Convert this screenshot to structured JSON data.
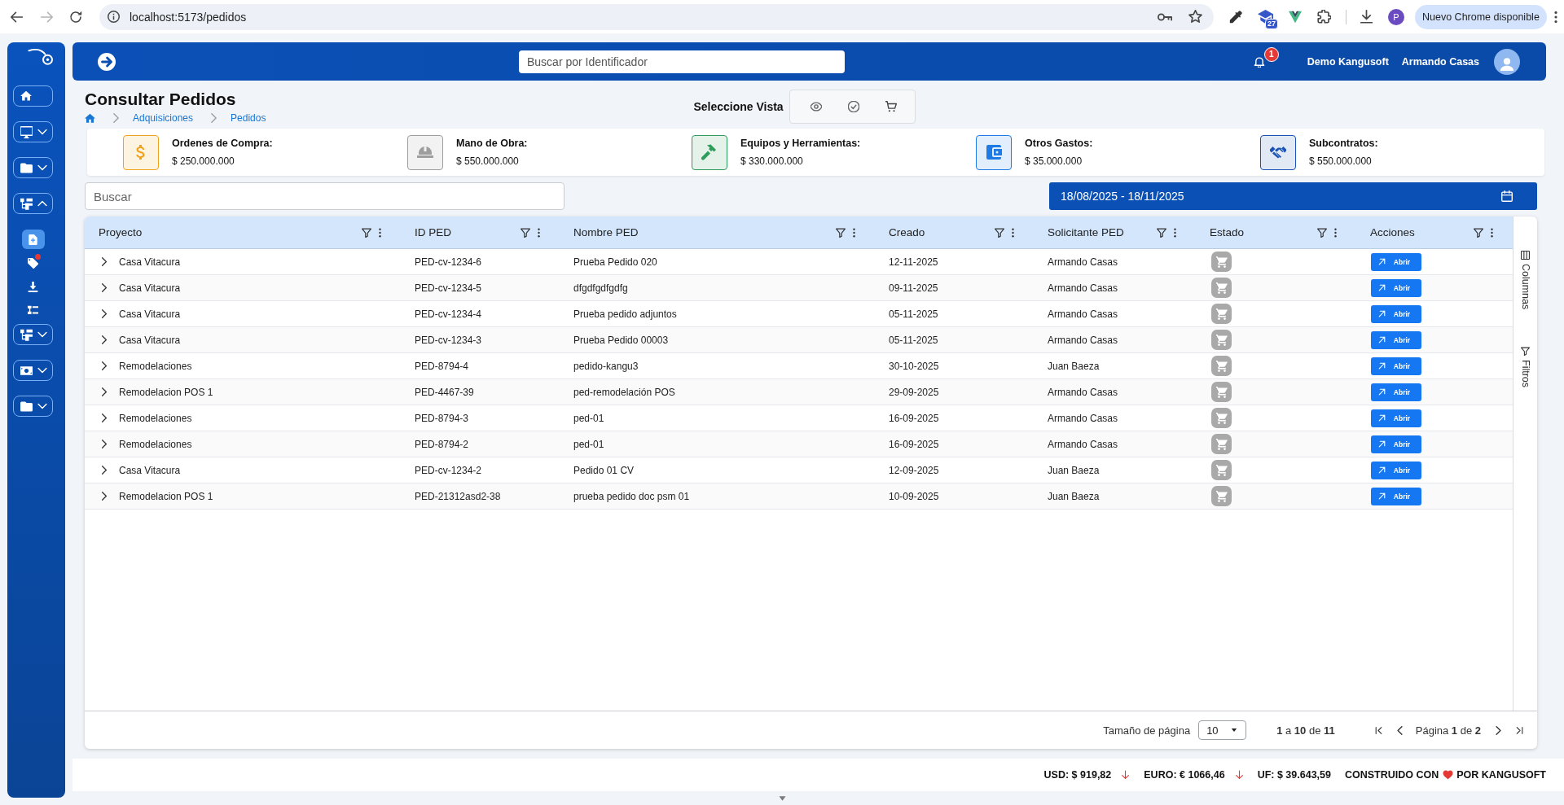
{
  "browser": {
    "url": "localhost:5173/pedidos",
    "extension_badge": "27",
    "profile_initial": "P",
    "update_button": "Nuevo Chrome disponible"
  },
  "sidebar": {
    "items": [
      {
        "kind": "link"
      },
      {
        "kind": "group",
        "expanded": false
      },
      {
        "kind": "group",
        "expanded": false
      },
      {
        "kind": "group",
        "expanded": true,
        "children": [
          {
            "selected": true,
            "notification": false
          },
          {
            "selected": false,
            "notification": true
          },
          {
            "selected": false,
            "notification": false
          },
          {
            "selected": false,
            "notification": false
          }
        ]
      },
      {
        "kind": "group",
        "expanded": false
      },
      {
        "kind": "group",
        "expanded": false
      },
      {
        "kind": "group",
        "expanded": false
      }
    ]
  },
  "header": {
    "search": {
      "placeholder": "Buscar por Identificador"
    },
    "notifications": "1",
    "company": "Demo Kangusoft",
    "user": "Armando Casas"
  },
  "page": {
    "title": "Consultar Pedidos",
    "breadcrumb": [
      "Adquisiciones",
      "Pedidos"
    ],
    "view_selector": {
      "label": "Seleccione Vista"
    }
  },
  "summary": [
    {
      "label": "Ordenes de Compra:",
      "value": "$ 250.000.000",
      "color": "#f0a31a"
    },
    {
      "label": "Mano de Obra:",
      "value": "$ 550.000.000",
      "color": "#9e9e9e"
    },
    {
      "label": "Equipos y Herramientas:",
      "value": "$ 330.000.000",
      "color": "#2e9d5c"
    },
    {
      "label": "Otros Gastos:",
      "value": "$ 35.000.000",
      "color": "#1e7be6"
    },
    {
      "label": "Subcontratos:",
      "value": "$ 550.000.000",
      "color": "#1a52b5"
    }
  ],
  "filters": {
    "search": {
      "placeholder": "Buscar"
    },
    "date_range": "18/08/2025 - 18/11/2025"
  },
  "table": {
    "columns": [
      "Proyecto",
      "ID PED",
      "Nombre PED",
      "Creado",
      "Solicitante PED",
      "Estado",
      "Acciones"
    ],
    "rows": [
      {
        "expanded": false,
        "cells": [
          "Casa Vitacura",
          "PED-cv-1234-6",
          "Prueba Pedido 020",
          "12-11-2025",
          "Armando Casas"
        ],
        "action": "Abrir"
      },
      {
        "expanded": false,
        "cells": [
          "Casa Vitacura",
          "PED-cv-1234-5",
          "dfgdfgdfgdfg",
          "09-11-2025",
          "Armando Casas"
        ],
        "action": "Abrir"
      },
      {
        "expanded": false,
        "cells": [
          "Casa Vitacura",
          "PED-cv-1234-4",
          "Prueba pedido adjuntos",
          "05-11-2025",
          "Armando Casas"
        ],
        "action": "Abrir"
      },
      {
        "expanded": false,
        "cells": [
          "Casa Vitacura",
          "PED-cv-1234-3",
          "Prueba Pedido 00003",
          "05-11-2025",
          "Armando Casas"
        ],
        "action": "Abrir"
      },
      {
        "expanded": false,
        "cells": [
          "Remodelaciones",
          "PED-8794-4",
          "pedido-kangu3",
          "30-10-2025",
          "Juan Baeza"
        ],
        "action": "Abrir"
      },
      {
        "expanded": false,
        "cells": [
          "Remodelacion POS 1",
          "PED-4467-39",
          "ped-remodelación POS",
          "29-09-2025",
          "Armando Casas"
        ],
        "action": "Abrir"
      },
      {
        "expanded": false,
        "cells": [
          "Remodelaciones",
          "PED-8794-3",
          "ped-01",
          "16-09-2025",
          "Armando Casas"
        ],
        "action": "Abrir"
      },
      {
        "expanded": false,
        "cells": [
          "Remodelaciones",
          "PED-8794-2",
          "ped-01",
          "16-09-2025",
          "Armando Casas"
        ],
        "action": "Abrir"
      },
      {
        "expanded": false,
        "cells": [
          "Casa Vitacura",
          "PED-cv-1234-2",
          "Pedido 01 CV",
          "12-09-2025",
          "Juan Baeza"
        ],
        "action": "Abrir"
      },
      {
        "expanded": false,
        "cells": [
          "Remodelacion POS 1",
          "PED-21312asd2-38",
          "prueba pedido doc psm 01",
          "10-09-2025",
          "Juan Baeza"
        ],
        "action": "Abrir"
      }
    ],
    "side_panel": [
      "Columnas",
      "Filtros"
    ],
    "pagination": {
      "page_size_label": "Tamaño de página",
      "page_size": "10",
      "range": "**1** a **10** de **11**",
      "page": "Página **1** de **2**"
    }
  },
  "footer": {
    "rates": [
      {
        "text": "USD: $ 919,82",
        "falling": true
      },
      {
        "text": "EURO: € 1066,46",
        "falling": true
      },
      {
        "text": "UF: $ 39.643,59"
      }
    ],
    "credit_before": "CONSTRUIDO CON",
    "credit_after": "POR KANGUSOFT"
  }
}
